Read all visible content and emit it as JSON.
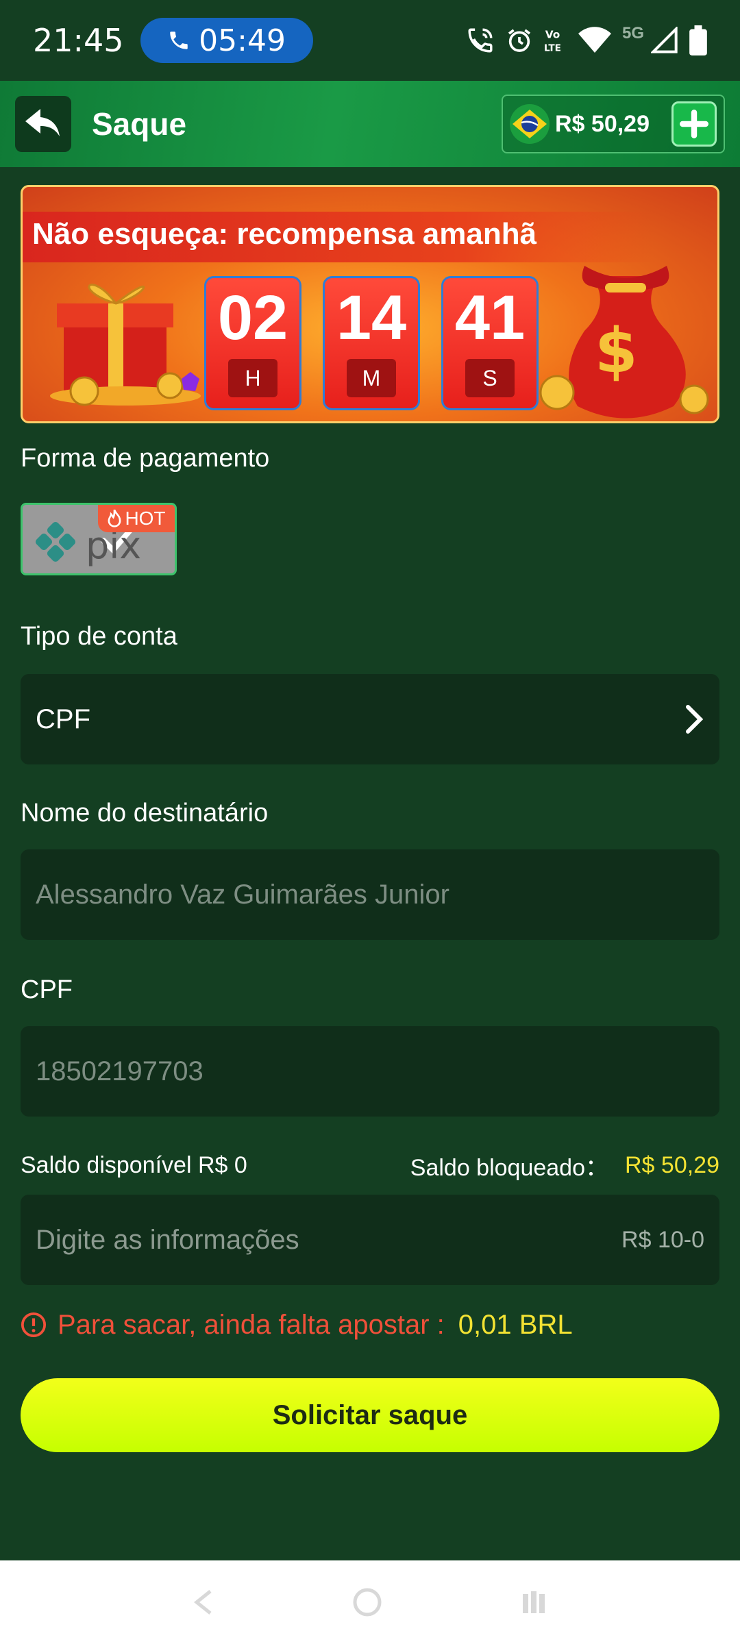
{
  "status_bar": {
    "time": "21:45",
    "call_duration": "05:49",
    "network_label": "5G"
  },
  "header": {
    "title": "Saque",
    "balance": "R$ 50,29"
  },
  "banner": {
    "title": "Não esqueça: recompensa amanhã",
    "countdown": [
      {
        "value": "02",
        "unit": "H"
      },
      {
        "value": "14",
        "unit": "M"
      },
      {
        "value": "41",
        "unit": "S"
      }
    ]
  },
  "payment": {
    "label": "Forma de pagamento",
    "method": "pix",
    "badge": "HOT"
  },
  "account_type": {
    "label": "Tipo de conta",
    "value": "CPF"
  },
  "recipient": {
    "label": "Nome do destinatário",
    "placeholder": "Alessandro Vaz Guimarães Junior"
  },
  "cpf": {
    "label": "CPF",
    "placeholder": "18502197703"
  },
  "saldo": {
    "available": "Saldo disponível R$ 0",
    "locked_label": "Saldo bloqueado：",
    "locked_value": "R$ 50,29"
  },
  "amount": {
    "placeholder": "Digite as informações",
    "range": "R$ 10-0"
  },
  "warning": {
    "text": "Para sacar, ainda falta apostar :",
    "value": "0,01 BRL"
  },
  "submit": {
    "label": "Solicitar saque"
  },
  "colors": {
    "background": "#143f22",
    "header": "#0f7a36",
    "accent_yellow": "#f3e233",
    "warning_red": "#f0503a",
    "button": "#d7ff00"
  }
}
